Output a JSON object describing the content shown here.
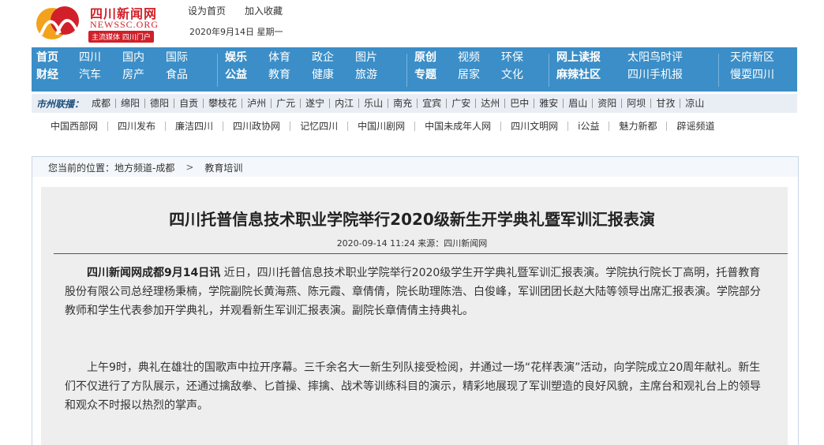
{
  "logo": {
    "cn": "四川新闻网",
    "en": "NEWSSC.ORG",
    "tag": "主流媒体 四川门户"
  },
  "top_links": [
    "设为首页",
    "加入收藏"
  ],
  "date": "2020年9月14日  星期一",
  "nav_groups": [
    {
      "bold": true,
      "rows": [
        [
          "首页"
        ],
        [
          "财经"
        ]
      ]
    },
    {
      "bold": false,
      "rows": [
        [
          "四川",
          "国内",
          "国际"
        ],
        [
          "汽车",
          "房产",
          "食品"
        ]
      ]
    },
    {
      "bold": true,
      "rows": [
        [
          "娱乐"
        ],
        [
          "公益"
        ]
      ]
    },
    {
      "bold": false,
      "rows": [
        [
          "体育",
          "政企",
          "图片"
        ],
        [
          "教育",
          "健康",
          "旅游"
        ]
      ]
    },
    {
      "bold": true,
      "rows": [
        [
          "原创"
        ],
        [
          "专题"
        ]
      ]
    },
    {
      "bold": false,
      "rows": [
        [
          "视频",
          "环保"
        ],
        [
          "居家",
          "文化"
        ]
      ]
    },
    {
      "bold": true,
      "rows": [
        [
          "网上读报"
        ],
        [
          "麻辣社区"
        ]
      ]
    },
    {
      "bold": false,
      "rows": [
        [
          "太阳鸟时评"
        ],
        [
          "四川手机报"
        ]
      ]
    },
    {
      "bold": false,
      "rows": [
        [
          "天府新区"
        ],
        [
          "慢耍四川"
        ]
      ]
    }
  ],
  "city_label": "市州联播：",
  "cities": [
    "成都",
    "绵阳",
    "德阳",
    "自贡",
    "攀枝花",
    "泸州",
    "广元",
    "遂宁",
    "内江",
    "乐山",
    "南充",
    "宜宾",
    "广安",
    "达州",
    "巴中",
    "雅安",
    "眉山",
    "资阳",
    "阿坝",
    "甘孜",
    "凉山"
  ],
  "links": [
    "中国西部网",
    "四川发布",
    "廉洁四川",
    "四川政协网",
    "记忆四川",
    "中国川剧网",
    "中国未成年人网",
    "四川文明网",
    "i公益",
    "魅力新都",
    "辟谣频道"
  ],
  "breadcrumb": {
    "label": "您当前的位置：地方频道-成都",
    "sep": ">",
    "current": "教育培训"
  },
  "article": {
    "title": "四川托普信息技术职业学院举行2020级新生开学典礼暨军训汇报表演",
    "meta": "2020-09-14 11:24 来源：四川新闻网",
    "lead": "四川新闻网成都9月14日讯",
    "p1": " 近日，四川托普信息技术职业学院举行2020级学生开学典礼暨军训汇报表演。学院执行院长丁高明，托普教育股份有限公司总经理杨秉楠，学院副院长黄海燕、陈元霞、章倩倩，院长助理陈浩、白俊峰，军训团团长赵大陆等领导出席汇报表演。学院部分教师和学生代表参加开学典礼，并观看新生军训汇报表演。副院长章倩倩主持典礼。",
    "p2": "上午9时，典礼在雄壮的国歌声中拉开序幕。三千余名大一新生列队接受检阅，并通过一场“花样表演”活动，向学院成立20周年献礼。新生们不仅进行了方队展示，还通过擒敌拳、匕首操、摔擒、战术等训练科目的演示，精彩地展现了军训塑造的良好风貌，主席台和观礼台上的领导和观众不时报以热烈的掌声。"
  },
  "colors": {
    "nav": "#3b8ec7",
    "brand_red": "#d1202a"
  }
}
